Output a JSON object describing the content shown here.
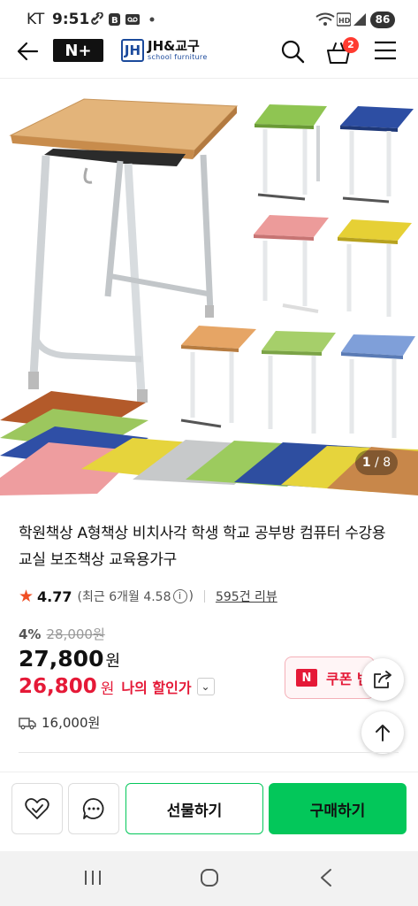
{
  "status_bar": {
    "carrier": "KT",
    "time": "9:51",
    "battery": "86"
  },
  "header": {
    "nplus_logo": "N+",
    "store_name": "JH&교구",
    "store_subtitle": "school furniture",
    "cart_count": "2"
  },
  "gallery": {
    "current": "1",
    "separator": "/",
    "total": "8"
  },
  "product": {
    "title": "학원책상 A형책상 비치사각 학생 학교 공부방 컴퓨터 수강용 교실 보조책상 교육용가구",
    "rating": "4.77",
    "recent_rating": "(최근 6개월 4.58",
    "recent_close": ")",
    "review_count": "595건 리뷰",
    "discount_pct": "4%",
    "original_price": "28,000원",
    "price": "27,800",
    "price_unit": "원",
    "my_price": "26,800",
    "my_price_unit": "원",
    "my_price_label": "나의 할인가",
    "coupon_label": "쿠폰 받",
    "shipping_fee": "16,000원"
  },
  "actions": {
    "gift_label": "선물하기",
    "buy_label": "구매하기"
  },
  "colors": {
    "naver_green": "#03c75a",
    "discount_red": "#e51937",
    "badge_red": "#ff3b30",
    "star": "#f04e23"
  }
}
